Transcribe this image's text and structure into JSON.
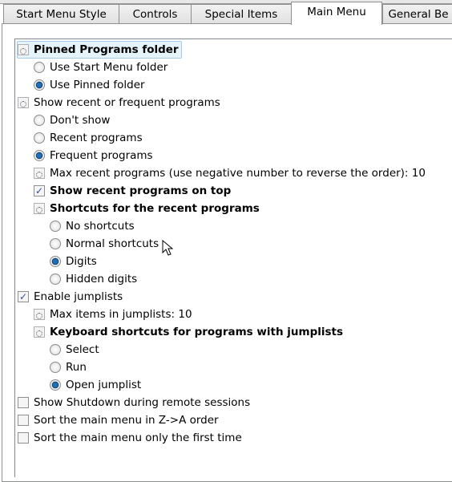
{
  "tabs": [
    {
      "label": "Start Menu Style",
      "selected": false
    },
    {
      "label": "Controls",
      "selected": false
    },
    {
      "label": "Special Items",
      "selected": false
    },
    {
      "label": "Main Menu",
      "selected": true
    },
    {
      "label": "General Be",
      "selected": false
    }
  ],
  "items": [
    {
      "type": "group",
      "label": "Pinned Programs folder",
      "level": 0,
      "bold": true,
      "highlighted": true
    },
    {
      "type": "radio",
      "label": "Use Start Menu folder",
      "level": 1,
      "checked": false
    },
    {
      "type": "radio",
      "label": "Use Pinned folder",
      "level": 1,
      "checked": true
    },
    {
      "type": "group",
      "label": "Show recent or frequent programs",
      "level": 0,
      "bold": false
    },
    {
      "type": "radio",
      "label": "Don't show",
      "level": 1,
      "checked": false
    },
    {
      "type": "radio",
      "label": "Recent programs",
      "level": 1,
      "checked": false
    },
    {
      "type": "radio",
      "label": "Frequent programs",
      "level": 1,
      "checked": true
    },
    {
      "type": "group",
      "label": "Max recent programs (use negative number to reverse the order): 10",
      "level": 1,
      "bold": false
    },
    {
      "type": "check",
      "label": "Show recent programs on top",
      "level": 1,
      "checked": true,
      "bold": true
    },
    {
      "type": "group",
      "label": "Shortcuts for the recent programs",
      "level": 1,
      "bold": true
    },
    {
      "type": "radio",
      "label": "No shortcuts",
      "level": 2,
      "checked": false
    },
    {
      "type": "radio",
      "label": "Normal shortcuts",
      "level": 2,
      "checked": false
    },
    {
      "type": "radio",
      "label": "Digits",
      "level": 2,
      "checked": true
    },
    {
      "type": "radio",
      "label": "Hidden digits",
      "level": 2,
      "checked": false
    },
    {
      "type": "check",
      "label": "Enable jumplists",
      "level": 0,
      "checked": true
    },
    {
      "type": "group",
      "label": "Max items in jumplists: 10",
      "level": 1,
      "bold": false
    },
    {
      "type": "group",
      "label": "Keyboard shortcuts for programs with jumplists",
      "level": 1,
      "bold": true
    },
    {
      "type": "radio",
      "label": "Select",
      "level": 2,
      "checked": false
    },
    {
      "type": "radio",
      "label": "Run",
      "level": 2,
      "checked": false
    },
    {
      "type": "radio",
      "label": "Open jumplist",
      "level": 2,
      "checked": true
    },
    {
      "type": "check",
      "label": "Show Shutdown during remote sessions",
      "level": 0,
      "checked": false
    },
    {
      "type": "check",
      "label": "Sort the main menu in Z->A order",
      "level": 0,
      "checked": false
    },
    {
      "type": "check",
      "label": "Sort the main menu only the first time",
      "level": 0,
      "checked": false
    }
  ]
}
